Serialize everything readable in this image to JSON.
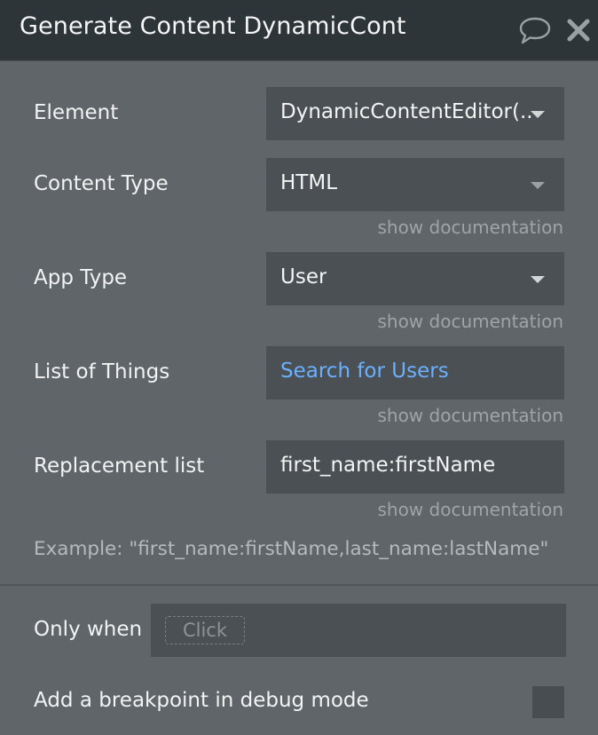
{
  "header": {
    "title": "Generate Content DynamicCont"
  },
  "fields": {
    "element": {
      "label": "Element",
      "value": "DynamicContentEditor(..."
    },
    "content_type": {
      "label": "Content Type",
      "value": "HTML",
      "doc": "show documentation"
    },
    "app_type": {
      "label": "App Type",
      "value": "User",
      "doc": "show documentation"
    },
    "list_of_things": {
      "label": "List of Things",
      "value": "Search for Users",
      "doc": "show documentation"
    },
    "replacement_list": {
      "label": "Replacement list",
      "value": "first_name:firstName",
      "doc": "show documentation"
    }
  },
  "example": "Example: \"first_name:firstName,last_name:lastName\"",
  "only_when": {
    "label": "Only when",
    "placeholder": "Click"
  },
  "breakpoint": {
    "label": "Add a breakpoint in debug mode",
    "checked": false
  },
  "icons": [
    "comment-icon",
    "close-icon",
    "chevron-down-icon"
  ],
  "colors": {
    "header_bg": "#2e3538",
    "panel_bg": "#5f6568",
    "field_bg": "#4a5053",
    "link": "#6bb0ff"
  }
}
